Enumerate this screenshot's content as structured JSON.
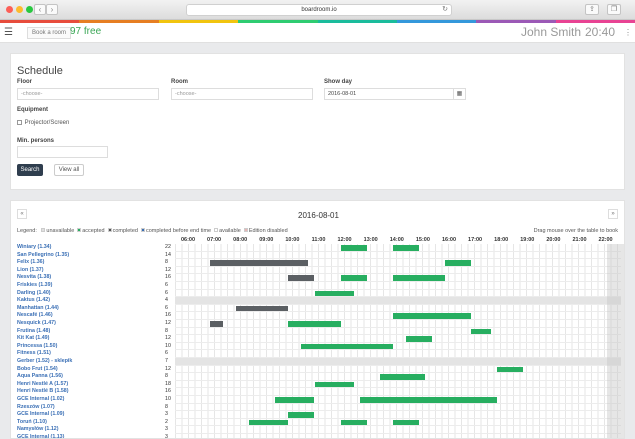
{
  "browser": {
    "url": "boardroom.io"
  },
  "header": {
    "book_label": "Book a room",
    "free_count": "97",
    "free_label": "free",
    "user": "John Smith",
    "time": "20:40"
  },
  "filter": {
    "title": "Schedule",
    "floor_label": "Floor",
    "floor_value": "-choose-",
    "room_label": "Room",
    "room_value": "-choose-",
    "day_label": "Show day",
    "day_value": "2016-08-01",
    "equipment_label": "Equipment",
    "equipment_option": "Projector/Screen",
    "min_persons_label": "Min. persons",
    "search_label": "Search",
    "view_all_label": "View all"
  },
  "calendar": {
    "date": "2016-08-01",
    "prev": "«",
    "next": "»",
    "legend_title": "Legend:",
    "legend": [
      {
        "label": "unavailable",
        "color": "#e0e0e0"
      },
      {
        "label": "accepted",
        "color": "#27ae60"
      },
      {
        "label": "completed",
        "color": "#555555"
      },
      {
        "label": "completed before end time",
        "color": "#3a6fb5"
      },
      {
        "label": "available",
        "color": "#ffffff"
      },
      {
        "label": "Edition disabled",
        "color": "#e8b4b4"
      }
    ],
    "drag_hint": "Drag mouse over the table to book",
    "hours": [
      "06:00",
      "07:00",
      "08:00",
      "09:00",
      "10:00",
      "11:00",
      "12:00",
      "13:00",
      "14:00",
      "15:00",
      "16:00",
      "17:00",
      "18:00",
      "19:00",
      "20:00",
      "21:00",
      "22:00"
    ],
    "colors": {
      "accepted": "#27ae60",
      "completed": "#5b5f63"
    },
    "rooms": [
      {
        "name": "Winiary (1.34)",
        "cap": "22",
        "bars": [
          [
            12,
            13,
            "accepted"
          ],
          [
            14,
            15,
            "accepted"
          ]
        ]
      },
      {
        "name": "San Pellegrino (1.35)",
        "cap": "14",
        "bars": []
      },
      {
        "name": "Felix (1.36)",
        "cap": "8",
        "bars": [
          [
            7,
            10.75,
            "completed"
          ],
          [
            16,
            17,
            "accepted"
          ]
        ]
      },
      {
        "name": "Lion (1.37)",
        "cap": "12",
        "bars": []
      },
      {
        "name": "Nesvita (1.38)",
        "cap": "16",
        "bars": [
          [
            10,
            11,
            "completed"
          ],
          [
            12,
            13,
            "accepted"
          ],
          [
            14,
            16,
            "accepted"
          ]
        ]
      },
      {
        "name": "Friskies (1.39)",
        "cap": "6",
        "bars": []
      },
      {
        "name": "Darling (1.40)",
        "cap": "6",
        "bars": [
          [
            11,
            12.5,
            "accepted"
          ]
        ]
      },
      {
        "name": "Kaktus (1.42)",
        "cap": "4",
        "gray": true,
        "bars": []
      },
      {
        "name": "Manhattan (1.44)",
        "cap": "6",
        "bars": [
          [
            8,
            10,
            "completed"
          ]
        ]
      },
      {
        "name": "Nescafé (1.46)",
        "cap": "16",
        "bars": [
          [
            14,
            17,
            "accepted"
          ]
        ]
      },
      {
        "name": "Nesquick (1.47)",
        "cap": "12",
        "bars": [
          [
            7,
            7.5,
            "completed"
          ],
          [
            10,
            12,
            "accepted"
          ]
        ]
      },
      {
        "name": "Frutina (1.48)",
        "cap": "8",
        "bars": [
          [
            17,
            17.75,
            "accepted"
          ]
        ]
      },
      {
        "name": "Kit Kat (1.49)",
        "cap": "12",
        "bars": [
          [
            14.5,
            15.5,
            "accepted"
          ]
        ]
      },
      {
        "name": "Princessa (1.50)",
        "cap": "10",
        "bars": [
          [
            10.5,
            14,
            "accepted"
          ]
        ]
      },
      {
        "name": "Fitness (1.51)",
        "cap": "6",
        "bars": []
      },
      {
        "name": "Gerber (1.52) - sklepik",
        "cap": "7",
        "gray": true,
        "bars": []
      },
      {
        "name": "Bobo Frut (1.54)",
        "cap": "12",
        "bars": [
          [
            18,
            19,
            "accepted"
          ]
        ]
      },
      {
        "name": "Aqua Panna (1.56)",
        "cap": "8",
        "bars": [
          [
            13.5,
            15.25,
            "accepted"
          ]
        ]
      },
      {
        "name": "Henri Nestlé A (1.57)",
        "cap": "18",
        "bars": [
          [
            11,
            12.5,
            "accepted"
          ]
        ]
      },
      {
        "name": "Henri Nestlé B (1.58)",
        "cap": "16",
        "bars": []
      },
      {
        "name": "GCE Internal (1.02)",
        "cap": "10",
        "bars": [
          [
            9.5,
            11,
            "accepted"
          ],
          [
            12.75,
            18,
            "accepted"
          ]
        ]
      },
      {
        "name": "Rzeszów (1.07)",
        "cap": "8",
        "bars": []
      },
      {
        "name": "GCE Internal (1.09)",
        "cap": "3",
        "bars": [
          [
            10,
            11,
            "accepted"
          ]
        ]
      },
      {
        "name": "Toruń (1.10)",
        "cap": "2",
        "bars": [
          [
            8.5,
            10,
            "accepted"
          ],
          [
            12,
            13,
            "accepted"
          ],
          [
            14,
            15,
            "accepted"
          ]
        ]
      },
      {
        "name": "Namysłów (1.12)",
        "cap": "3",
        "bars": []
      },
      {
        "name": "GCE Internal (1.13)",
        "cap": "3",
        "bars": []
      }
    ]
  }
}
